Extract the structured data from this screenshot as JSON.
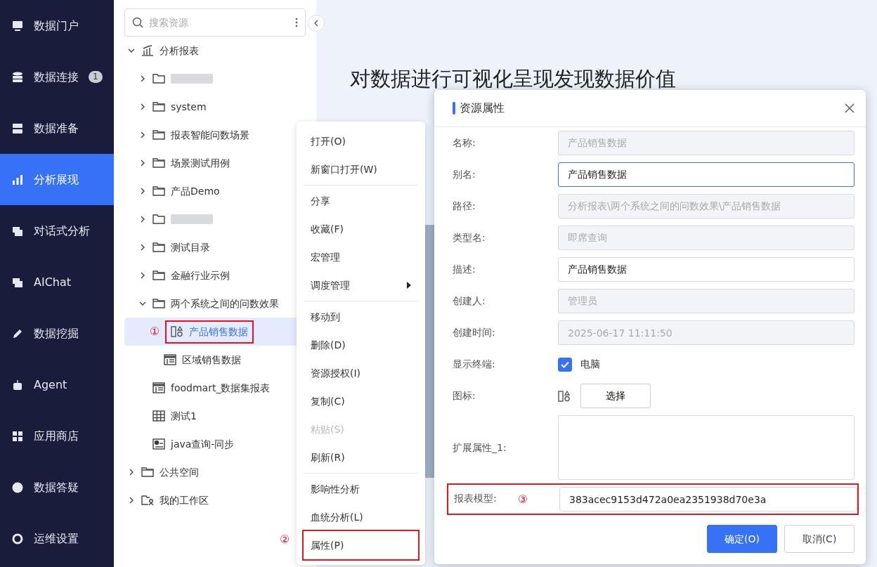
{
  "sidebar": {
    "items": [
      {
        "label": "数据门户",
        "selected": false
      },
      {
        "label": "数据连接",
        "badge": "1",
        "selected": false
      },
      {
        "label": "数据准备",
        "selected": false
      },
      {
        "label": "分析展现",
        "selected": true
      },
      {
        "label": "对话式分析",
        "selected": false
      },
      {
        "label": "AIChat",
        "selected": false
      },
      {
        "label": "数据挖掘",
        "selected": false
      },
      {
        "label": "Agent",
        "selected": false
      },
      {
        "label": "应用商店",
        "selected": false
      },
      {
        "label": "数据答疑",
        "selected": false
      },
      {
        "label": "运维设置",
        "selected": false
      }
    ]
  },
  "tree": {
    "search": {
      "placeholder": "搜索资源"
    },
    "items": [
      {
        "kind": "chart",
        "label": "分析报表",
        "expanded": true,
        "selected": false,
        "children": [
          {
            "kind": "redacted",
            "expanded": false,
            "selected": false
          },
          {
            "kind": "folder",
            "label": "system",
            "expanded": false,
            "selected": false
          },
          {
            "kind": "folder",
            "label": "报表智能问数场景",
            "expanded": false,
            "selected": false
          },
          {
            "kind": "folder",
            "label": "场景测试用例",
            "expanded": false,
            "selected": false
          },
          {
            "kind": "folder",
            "label": "产品Demo",
            "expanded": false,
            "selected": false
          },
          {
            "kind": "redacted",
            "expanded": false,
            "selected": false
          },
          {
            "kind": "folder",
            "label": "测试目录",
            "expanded": false,
            "selected": false
          },
          {
            "kind": "folder",
            "label": "金融行业示例",
            "expanded": false,
            "selected": false
          },
          {
            "kind": "folder",
            "label": "两个系统之间的问数效果",
            "expanded": true,
            "selected": false,
            "children": [
              {
                "kind": "query",
                "label": "产品销售数据",
                "selected": true,
                "annotation": "①"
              },
              {
                "kind": "report",
                "label": "区域销售数据",
                "selected": false
              }
            ]
          },
          {
            "kind": "report",
            "label": "foodmart_数据集报表",
            "selected": false
          },
          {
            "kind": "grid",
            "label": "测试1",
            "selected": false
          },
          {
            "kind": "dashboard",
            "label": "java查询-同步",
            "selected": false
          }
        ]
      },
      {
        "kind": "folder",
        "label": "公共空间",
        "expanded": false,
        "selected": false
      },
      {
        "kind": "userfolder",
        "label": "我的工作区",
        "expanded": false,
        "selected": false
      }
    ]
  },
  "main": {
    "heading": "对数据进行可视化呈现发现数据价值"
  },
  "context_menu": {
    "groups": [
      [
        {
          "label": "打开(O)",
          "disabled": false
        },
        {
          "label": "新窗口打开(W)",
          "disabled": false
        }
      ],
      [
        {
          "label": "分享",
          "disabled": false
        },
        {
          "label": "收藏(F)",
          "disabled": false
        },
        {
          "label": "宏管理",
          "disabled": false
        },
        {
          "label": "调度管理",
          "disabled": false,
          "submenu": true
        }
      ],
      [
        {
          "label": "移动到",
          "disabled": false
        },
        {
          "label": "删除(D)",
          "disabled": false
        },
        {
          "label": "资源授权(I)",
          "disabled": false
        },
        {
          "label": "复制(C)",
          "disabled": false
        },
        {
          "label": "粘贴(S)",
          "disabled": true
        },
        {
          "label": "刷新(R)",
          "disabled": false
        }
      ],
      [
        {
          "label": "影响性分析",
          "disabled": false
        },
        {
          "label": "血统分析(L)",
          "disabled": false
        },
        {
          "label": "属性(P)",
          "disabled": false,
          "annotation": "②"
        }
      ]
    ]
  },
  "dialog": {
    "title": "资源属性",
    "fields": [
      {
        "kind": "readonly",
        "label": "名称:",
        "value": "产品销售数据"
      },
      {
        "kind": "input",
        "label": "别名:",
        "value": "产品销售数据"
      },
      {
        "kind": "readonly",
        "label": "路径:",
        "value": "分析报表\\两个系统之间的问数效果\\产品销售数据"
      },
      {
        "kind": "readonly",
        "label": "类型名:",
        "value": "即席查询"
      },
      {
        "kind": "input",
        "label": "描述:",
        "value": "产品销售数据"
      },
      {
        "kind": "readonly",
        "label": "创建人:",
        "value": "管理员"
      },
      {
        "kind": "readonly",
        "label": "创建时间:",
        "value": "2025-06-17 11:11:50"
      },
      {
        "kind": "checkbox",
        "label": "显示终端:",
        "option": "电脑",
        "checked": true
      },
      {
        "kind": "icon",
        "label": "图标:",
        "button": "选择"
      },
      {
        "kind": "textarea",
        "label": "扩展属性_1:"
      },
      {
        "kind": "input",
        "label": "报表模型:",
        "value": "383acec9153d472a0ea2351938d70e3a",
        "annotation": "③"
      }
    ],
    "buttons": [
      {
        "label": "确定(O)",
        "primary": true
      },
      {
        "label": "取消(C)",
        "primary": false
      }
    ]
  }
}
